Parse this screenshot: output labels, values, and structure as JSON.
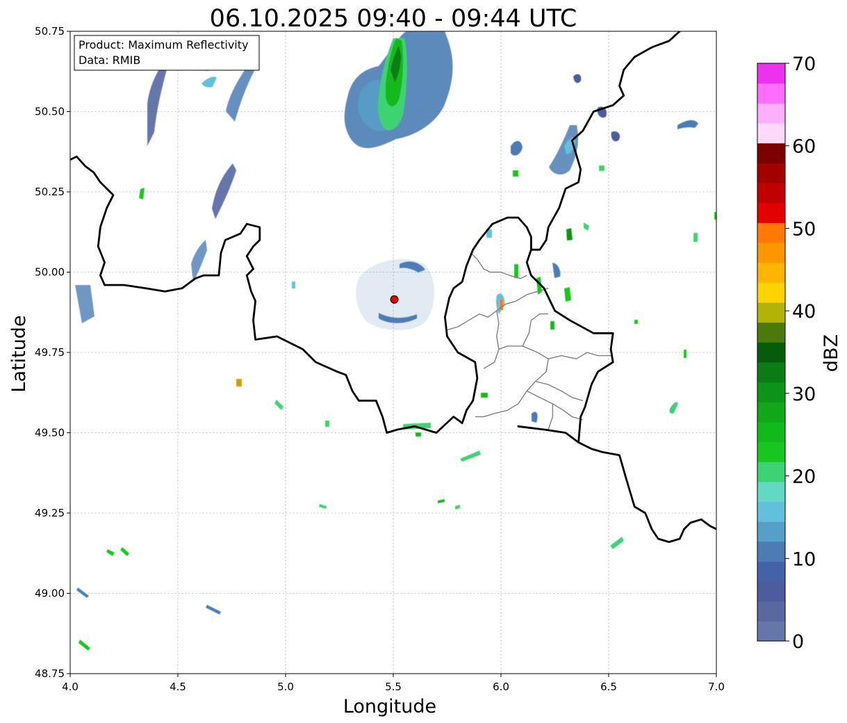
{
  "title": "06.10.2025 09:40 - 09:44 UTC",
  "info_box": {
    "product": "Product: Maximum Reflectivity",
    "data": "Data: RMIB"
  },
  "axes": {
    "xlabel": "Longitude",
    "ylabel": "Latitude",
    "xlim": [
      4.0,
      7.0
    ],
    "ylim": [
      48.75,
      50.75
    ],
    "xticks": [
      4.0,
      4.5,
      5.0,
      5.5,
      6.0,
      6.5,
      7.0
    ],
    "xtick_labels": [
      "4.0",
      "4.5",
      "5.0",
      "5.5",
      "6.0",
      "6.5",
      "7.0"
    ],
    "yticks": [
      48.75,
      49.0,
      49.25,
      49.5,
      49.75,
      50.0,
      50.25,
      50.5,
      50.75
    ],
    "ytick_labels": [
      "48.75",
      "49.00",
      "49.25",
      "49.50",
      "49.75",
      "50.00",
      "50.25",
      "50.50",
      "50.75"
    ],
    "grid": true
  },
  "colorbar": {
    "label": "dBZ",
    "min": 0,
    "max": 70,
    "ticks": [
      0,
      10,
      20,
      30,
      40,
      50,
      60,
      70
    ],
    "tick_labels": [
      "0",
      "10",
      "20",
      "30",
      "40",
      "50",
      "60",
      "70"
    ],
    "colors": [
      "#6577a8",
      "#59699f",
      "#4b5d9c",
      "#4462a8",
      "#4b7db4",
      "#569fc8",
      "#62c0dc",
      "#62d8c5",
      "#3cd372",
      "#17c71f",
      "#12b91b",
      "#10a81a",
      "#0c9417",
      "#097d13",
      "#075c0b",
      "#4a7a0b",
      "#b1b306",
      "#fed304",
      "#ffb400",
      "#fe9600",
      "#ff7a00",
      "#e50000",
      "#c10000",
      "#a30000",
      "#7c0000",
      "#fed9fe",
      "#fdaffd",
      "#fe6efe",
      "#ed32ef"
    ]
  },
  "radar_site": {
    "lon": 5.505,
    "lat": 49.915,
    "color": "#e50000"
  },
  "map_data": {
    "country_borders": [
      [
        [
          4.0,
          50.35
        ],
        [
          4.03,
          50.36
        ],
        [
          4.07,
          50.33
        ],
        [
          4.11,
          50.31
        ],
        [
          4.14,
          50.28
        ],
        [
          4.17,
          50.26
        ],
        [
          4.2,
          50.24
        ],
        [
          4.17,
          50.2
        ],
        [
          4.14,
          50.14
        ],
        [
          4.13,
          50.08
        ],
        [
          4.16,
          50.03
        ],
        [
          4.14,
          49.99
        ],
        [
          4.16,
          49.96
        ],
        [
          4.25,
          49.96
        ],
        [
          4.35,
          49.95
        ],
        [
          4.44,
          49.94
        ],
        [
          4.52,
          49.95
        ],
        [
          4.58,
          49.98
        ],
        [
          4.62,
          49.99
        ],
        [
          4.69,
          49.99
        ],
        [
          4.7,
          50.06
        ],
        [
          4.72,
          50.1
        ],
        [
          4.79,
          50.12
        ],
        [
          4.82,
          50.15
        ],
        [
          4.88,
          50.14
        ],
        [
          4.88,
          50.1
        ],
        [
          4.85,
          50.08
        ],
        [
          4.82,
          50.05
        ],
        [
          4.85,
          50.01
        ],
        [
          4.82,
          49.99
        ],
        [
          4.84,
          49.94
        ],
        [
          4.86,
          49.91
        ],
        [
          4.85,
          49.85
        ],
        [
          4.86,
          49.79
        ],
        [
          4.96,
          49.8
        ],
        [
          5.02,
          49.78
        ],
        [
          5.08,
          49.76
        ],
        [
          5.14,
          49.72
        ],
        [
          5.24,
          49.69
        ],
        [
          5.28,
          49.68
        ],
        [
          5.31,
          49.63
        ],
        [
          5.34,
          49.6
        ],
        [
          5.42,
          49.6
        ],
        [
          5.45,
          49.55
        ],
        [
          5.47,
          49.5
        ],
        [
          5.52,
          49.51
        ],
        [
          5.6,
          49.52
        ],
        [
          5.7,
          49.5
        ],
        [
          5.78,
          49.55
        ],
        [
          5.82,
          49.53
        ],
        [
          5.84,
          49.57
        ],
        [
          5.87,
          49.6
        ],
        [
          5.89,
          49.67
        ],
        [
          5.88,
          49.72
        ],
        [
          5.8,
          49.75
        ],
        [
          5.75,
          49.8
        ],
        [
          5.74,
          49.86
        ],
        [
          5.76,
          49.92
        ],
        [
          5.78,
          49.95
        ],
        [
          5.82,
          49.97
        ],
        [
          5.84,
          50.02
        ],
        [
          5.87,
          50.07
        ],
        [
          5.9,
          50.1
        ],
        [
          5.96,
          50.15
        ],
        [
          6.03,
          50.17
        ],
        [
          6.08,
          50.17
        ],
        [
          6.12,
          50.14
        ],
        [
          6.14,
          50.11
        ],
        [
          6.14,
          50.07
        ],
        [
          6.12,
          50.03
        ],
        [
          6.14,
          49.99
        ],
        [
          6.2,
          49.95
        ],
        [
          6.25,
          49.88
        ],
        [
          6.32,
          49.85
        ],
        [
          6.43,
          49.81
        ],
        [
          6.52,
          49.81
        ],
        [
          6.51,
          49.76
        ],
        [
          6.52,
          49.72
        ],
        [
          6.45,
          49.69
        ],
        [
          6.42,
          49.65
        ],
        [
          6.39,
          49.58
        ],
        [
          6.37,
          49.55
        ],
        [
          6.36,
          49.47
        ]
      ],
      [
        [
          6.83,
          50.75
        ],
        [
          6.78,
          50.72
        ],
        [
          6.7,
          50.7
        ],
        [
          6.62,
          50.67
        ],
        [
          6.57,
          50.63
        ],
        [
          6.55,
          50.58
        ],
        [
          6.57,
          50.55
        ],
        [
          6.52,
          50.52
        ],
        [
          6.43,
          50.5
        ],
        [
          6.38,
          50.44
        ],
        [
          6.33,
          50.41
        ],
        [
          6.37,
          50.32
        ],
        [
          6.36,
          50.28
        ],
        [
          6.3,
          50.26
        ],
        [
          6.27,
          50.2
        ],
        [
          6.22,
          50.14
        ],
        [
          6.21,
          50.1
        ],
        [
          6.18,
          50.07
        ],
        [
          6.14,
          50.07
        ]
      ],
      [
        [
          6.08,
          49.52
        ],
        [
          6.2,
          49.51
        ],
        [
          6.3,
          49.5
        ],
        [
          6.36,
          49.47
        ],
        [
          6.42,
          49.45
        ],
        [
          6.47,
          49.44
        ],
        [
          6.55,
          49.43
        ],
        [
          6.58,
          49.36
        ],
        [
          6.62,
          49.27
        ],
        [
          6.67,
          49.25
        ],
        [
          6.7,
          49.2
        ],
        [
          6.73,
          49.17
        ],
        [
          6.78,
          49.16
        ],
        [
          6.83,
          49.17
        ],
        [
          6.85,
          49.2
        ],
        [
          6.88,
          49.22
        ],
        [
          6.93,
          49.23
        ],
        [
          6.97,
          49.21
        ],
        [
          7.0,
          49.2
        ]
      ]
    ],
    "admin_boundaries": [
      [
        [
          5.75,
          49.82
        ],
        [
          5.8,
          49.83
        ],
        [
          5.85,
          49.85
        ],
        [
          5.9,
          49.87
        ],
        [
          5.94,
          49.86
        ],
        [
          5.98,
          49.88
        ],
        [
          6.02,
          49.9
        ],
        [
          6.07,
          49.91
        ],
        [
          6.12,
          49.93
        ],
        [
          6.17,
          49.94
        ],
        [
          6.22,
          49.95
        ]
      ],
      [
        [
          5.86,
          50.06
        ],
        [
          5.89,
          50.04
        ],
        [
          5.92,
          50.01
        ],
        [
          5.95,
          50.0
        ],
        [
          6.0,
          50.0
        ],
        [
          6.04,
          49.99
        ],
        [
          6.09,
          49.98
        ],
        [
          6.12,
          49.99
        ]
      ],
      [
        [
          5.98,
          49.88
        ],
        [
          5.99,
          49.84
        ],
        [
          5.98,
          49.8
        ],
        [
          5.99,
          49.76
        ],
        [
          5.97,
          49.72
        ],
        [
          5.92,
          49.7
        ]
      ],
      [
        [
          5.99,
          49.76
        ],
        [
          6.03,
          49.77
        ],
        [
          6.1,
          49.77
        ],
        [
          6.17,
          49.75
        ],
        [
          6.22,
          49.73
        ],
        [
          6.28,
          49.74
        ],
        [
          6.35,
          49.73
        ],
        [
          6.4,
          49.75
        ],
        [
          6.45,
          49.74
        ],
        [
          6.51,
          49.74
        ]
      ],
      [
        [
          6.1,
          49.77
        ],
        [
          6.13,
          49.81
        ],
        [
          6.14,
          49.85
        ],
        [
          6.18,
          49.87
        ],
        [
          6.22,
          49.87
        ]
      ],
      [
        [
          6.22,
          49.73
        ],
        [
          6.21,
          49.69
        ],
        [
          6.16,
          49.66
        ],
        [
          6.12,
          49.63
        ],
        [
          6.08,
          49.59
        ],
        [
          6.03,
          49.57
        ],
        [
          5.97,
          49.56
        ],
        [
          5.92,
          49.55
        ],
        [
          5.88,
          49.55
        ]
      ],
      [
        [
          6.12,
          49.63
        ],
        [
          6.18,
          49.61
        ],
        [
          6.24,
          49.59
        ],
        [
          6.29,
          49.57
        ],
        [
          6.33,
          49.55
        ],
        [
          6.38,
          49.54
        ]
      ],
      [
        [
          6.16,
          49.66
        ],
        [
          6.22,
          49.65
        ],
        [
          6.28,
          49.63
        ],
        [
          6.33,
          49.61
        ],
        [
          6.38,
          49.6
        ]
      ],
      [
        [
          6.24,
          49.59
        ],
        [
          6.24,
          49.55
        ],
        [
          6.22,
          49.51
        ]
      ]
    ]
  }
}
